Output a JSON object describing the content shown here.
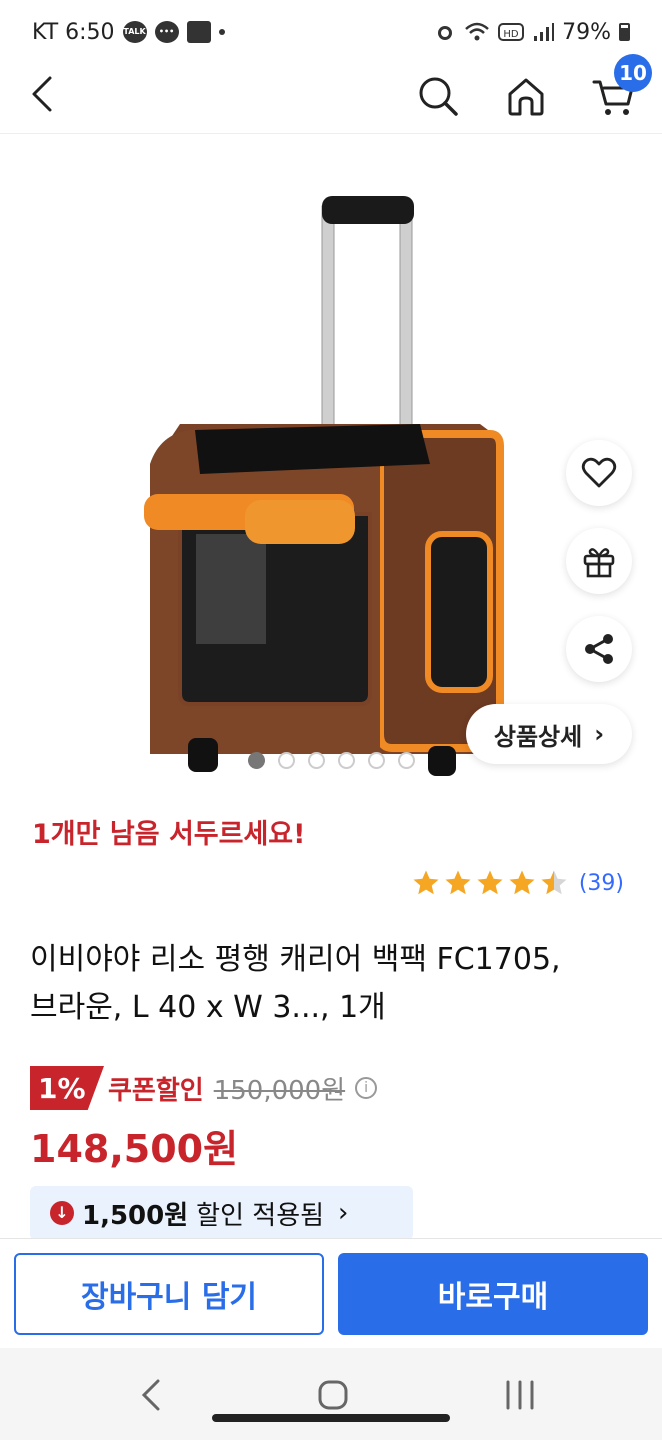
{
  "status_bar": {
    "carrier_time": "KT 6:50",
    "talk_label": "TALK",
    "battery": "79%"
  },
  "nav": {
    "cart_count": "10"
  },
  "gallery": {
    "image_count": 6,
    "active_index": 0,
    "detail_button": "상품상세",
    "detail_chevron": "›"
  },
  "product": {
    "stock_warning": "1개만 남음 서두르세요!",
    "rating": 4.5,
    "review_count": "(39)",
    "title_line1": "이비야야 리소 평행 캐리어 백팩 FC1705,",
    "title_line2": "브라운, L 40 x W 3..., 1개"
  },
  "price": {
    "discount_percent": "1%",
    "coupon_label": "쿠폰할인",
    "original_price": "150,000원",
    "info_icon_label": "i",
    "sale_price": "148,500원"
  },
  "discount_banner": {
    "amount": "1,500원",
    "text": "할인 적용됨",
    "chevron": "›"
  },
  "actions": {
    "add_to_cart": "장바구니 담기",
    "buy_now": "바로구매"
  },
  "colors": {
    "accent_blue": "#2a6de8",
    "sale_red": "#c8242b",
    "star_orange": "#f5a623"
  }
}
